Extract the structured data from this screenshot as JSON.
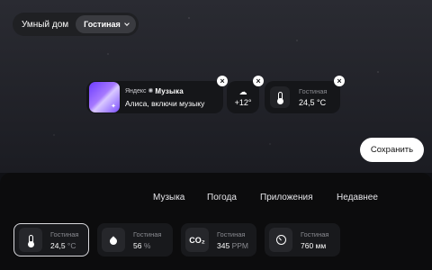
{
  "music_widget": {
    "brand_prefix": "Яндекс",
    "brand_name": "Музыка",
    "title": "Алиса, включи музыку"
  },
  "weather_widget": {
    "icon": "snow-cloud-icon",
    "temperature": "+12°"
  },
  "temperature_widget": {
    "icon": "thermometer-icon",
    "room": "Гостиная",
    "value": "24,5 °C"
  },
  "save_button": "Сохранить",
  "tabs": {
    "smart_home": "Умный дом",
    "room_selector": "Гостиная",
    "items": [
      "Музыка",
      "Погода",
      "Приложения",
      "Недавнее"
    ]
  },
  "devices": [
    {
      "icon": "thermometer-icon",
      "room": "Гостиная",
      "value": "24,5",
      "unit": "°C",
      "selected": true
    },
    {
      "icon": "humidity-drop-icon",
      "room": "Гостиная",
      "value": "56",
      "unit": "%",
      "selected": false
    },
    {
      "icon": "co2-icon",
      "icon_text": "CO₂",
      "room": "Гостиная",
      "value": "345",
      "unit": "PPM",
      "selected": false
    },
    {
      "icon": "pressure-gauge-icon",
      "room": "Гостиная",
      "value": "760 мм",
      "unit": "",
      "selected": false
    }
  ]
}
